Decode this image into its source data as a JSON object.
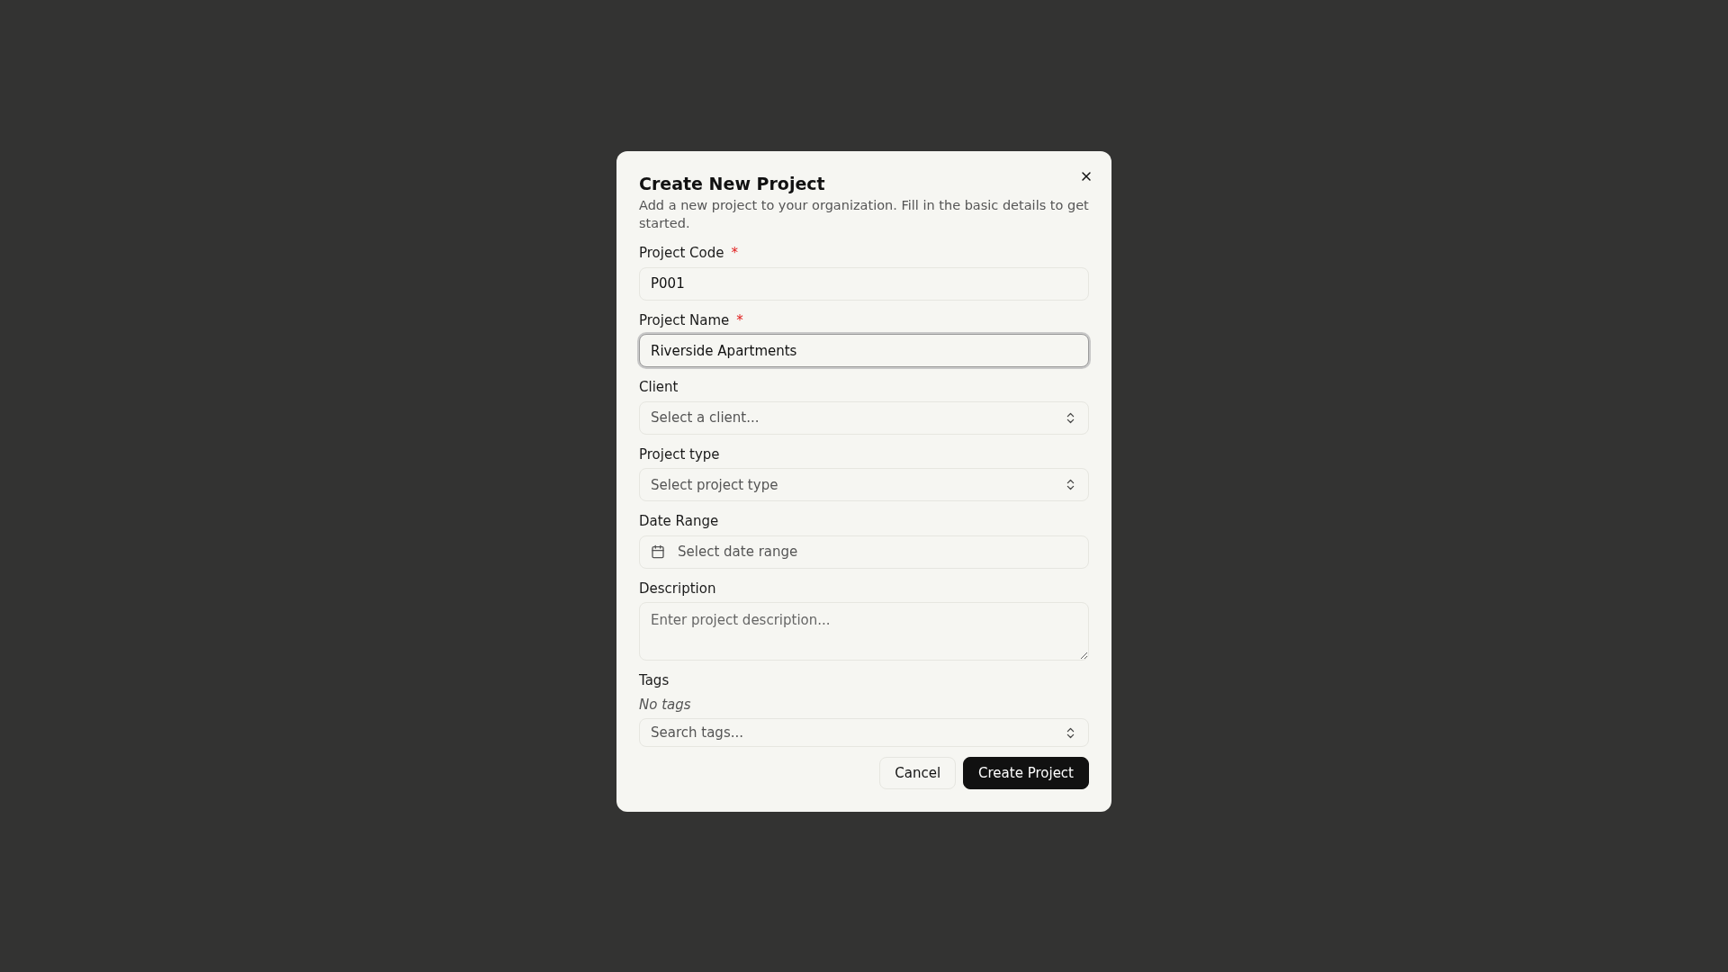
{
  "dialog": {
    "title": "Create New Project",
    "description": "Add a new project to your organization. Fill in the basic details to get started.",
    "fields": [
      {
        "kind": "text",
        "label": "Project Code",
        "required_mark": "*",
        "focused": false,
        "value": "P001"
      },
      {
        "kind": "text",
        "label": "Project Name",
        "required_mark": "*",
        "focused": true,
        "value": "Riverside Apartments"
      },
      {
        "kind": "select",
        "label": "Client",
        "placeholder": "Select a client..."
      },
      {
        "kind": "select",
        "label": "Project type",
        "placeholder": "Select project type"
      },
      {
        "kind": "date",
        "label": "Date Range",
        "placeholder": "Select date range"
      },
      {
        "kind": "textarea",
        "label": "Description",
        "placeholder": "Enter project description..."
      },
      {
        "kind": "tags",
        "label": "Tags",
        "empty_text": "No tags",
        "placeholder": "Search tags..."
      }
    ],
    "buttons": [
      {
        "label": "Cancel",
        "kind": "secondary"
      },
      {
        "label": "Create Project",
        "kind": "primary"
      }
    ]
  }
}
